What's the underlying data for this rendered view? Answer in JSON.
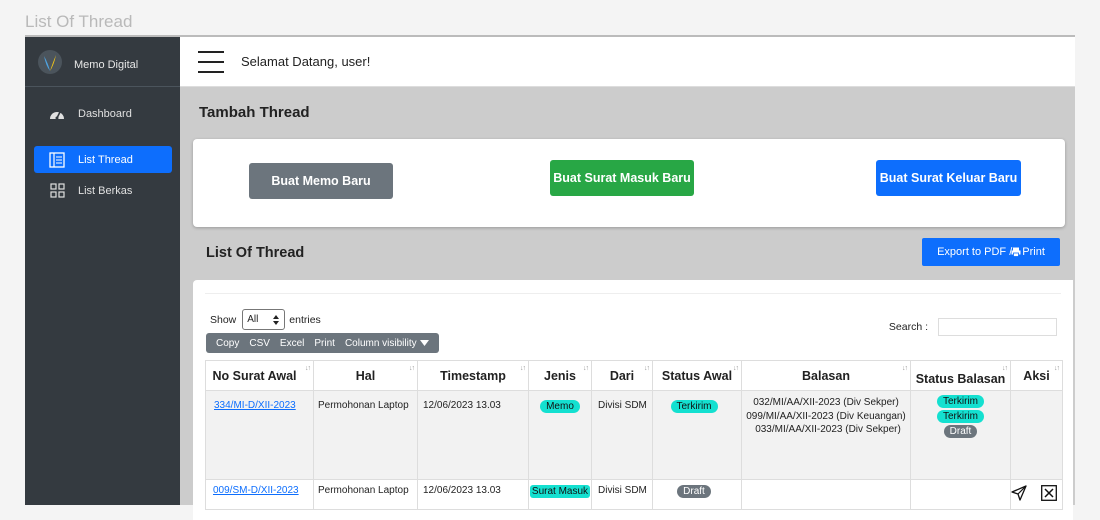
{
  "page_caption": "List Of Thread",
  "brand": {
    "name": "Memo Digital"
  },
  "sidebar": {
    "items": [
      {
        "label": "Dashboard",
        "icon": "speedometer-icon"
      },
      {
        "label": "List Thread",
        "icon": "list-icon",
        "active": true
      },
      {
        "label": "List Berkas",
        "icon": "grid-icon"
      }
    ]
  },
  "topbar": {
    "welcome": "Selamat Datang, user!"
  },
  "tambah": {
    "title": "Tambah Thread",
    "buttons": [
      {
        "label": "Buat Memo Baru",
        "color": "#6c757d"
      },
      {
        "label": "Buat Surat Masuk Baru",
        "color": "#28a745"
      },
      {
        "label": "Buat Surat Keluar Baru",
        "color": "#0d6efd"
      }
    ]
  },
  "list": {
    "title": "List Of Thread",
    "export_label": "Export to PDF / ",
    "print_label": "Print",
    "show_label": "Show",
    "length_value": "All",
    "entries_label": "entries",
    "search_label": "Search :",
    "search_value": "",
    "dt_buttons": [
      "Copy",
      "CSV",
      "Excel",
      "Print",
      "Column visibility"
    ],
    "columns": [
      "No Surat Awal",
      "Hal",
      "Timestamp",
      "Jenis",
      "Dari",
      "Status Awal",
      "Balasan",
      "Status Balasan",
      "Aksi"
    ],
    "rows": [
      {
        "no": "334/MI-D/XII-2023",
        "hal": "Permohonan Laptop",
        "timestamp": "12/06/2023 13.03",
        "jenis": "Memo",
        "dari": "Divisi SDM",
        "status_awal": "Terkirim",
        "balasan": [
          "032/MI/AA/XII-2023 (Div Sekper)",
          "099/MI/AA/XII-2023 (Div Keuangan)",
          "033/MI/AA/XII-2023 (Div Sekper)"
        ],
        "status_balasan": [
          "Terkirim",
          "Terkirim",
          "Draft"
        ]
      },
      {
        "no": "009/SM-D/XII-2023",
        "hal": "Permohonan Laptop",
        "timestamp": "12/06/2023 13.03",
        "jenis": "Surat Masuk",
        "dari": "Divisi SDM",
        "status_awal": "Draft",
        "balasan": [],
        "status_balasan": []
      }
    ]
  },
  "colors": {
    "sidebar": "#343a40",
    "accent": "#0d6efd",
    "pill_cyan": "#14e0d0",
    "pill_grey": "#6c757d"
  }
}
